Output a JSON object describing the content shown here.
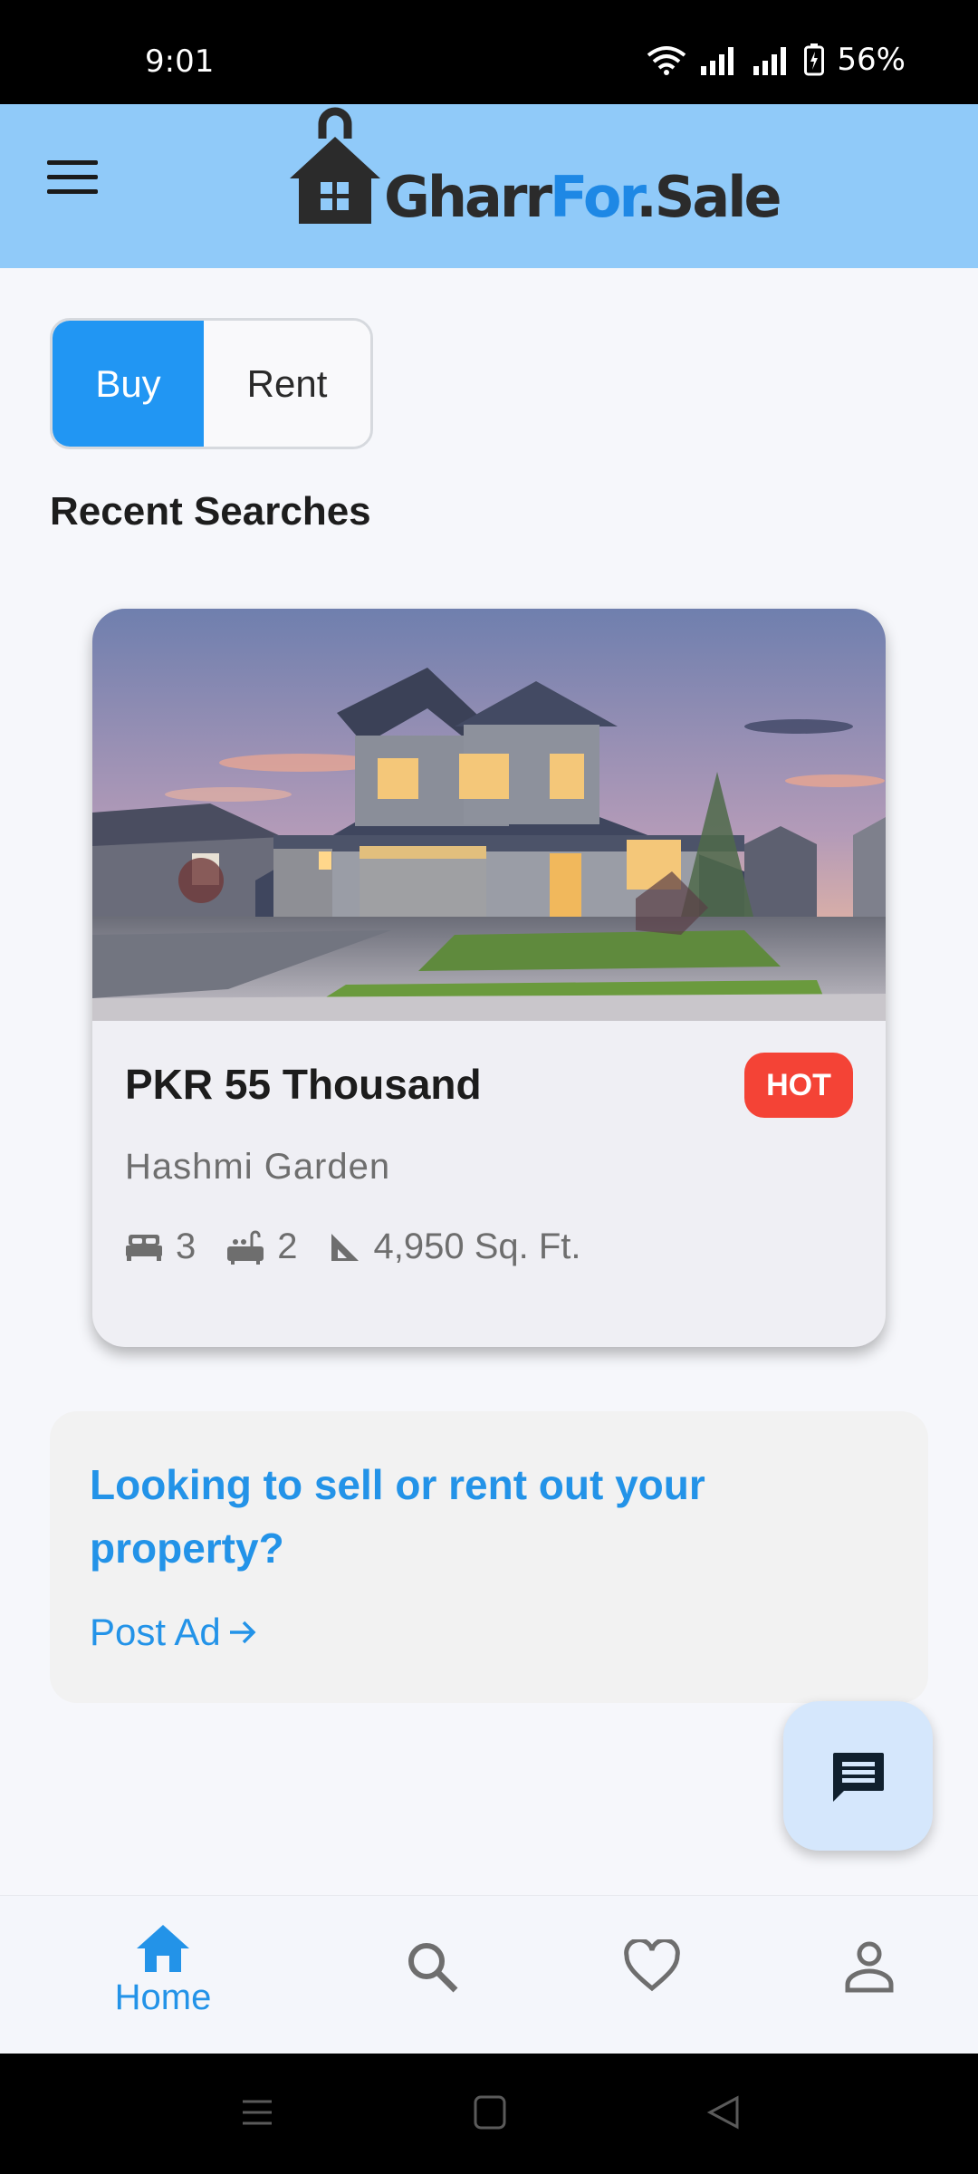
{
  "status_bar": {
    "time": "9:01",
    "battery": "56%"
  },
  "header": {
    "logo_text_part1": "Gharr",
    "logo_text_part2": "For",
    "logo_text_part3": ".Sale"
  },
  "toggle": {
    "buy_label": "Buy",
    "rent_label": "Rent",
    "selected": "Buy"
  },
  "recent": {
    "title": "Recent Searches",
    "card": {
      "price": "PKR 55 Thousand",
      "badge": "HOT",
      "location": "Hashmi Garden",
      "beds": "3",
      "baths": "2",
      "area": "4,950 Sq. Ft."
    }
  },
  "sell_banner": {
    "title": "Looking to sell or rent out your property?",
    "cta": "Post Ad"
  },
  "bottom_nav": {
    "items": [
      {
        "label": "Home",
        "active": true
      }
    ]
  },
  "colors": {
    "accent": "#2196f3",
    "app_bar": "#90caf9",
    "hot": "#f44336",
    "link": "#2393e8"
  }
}
